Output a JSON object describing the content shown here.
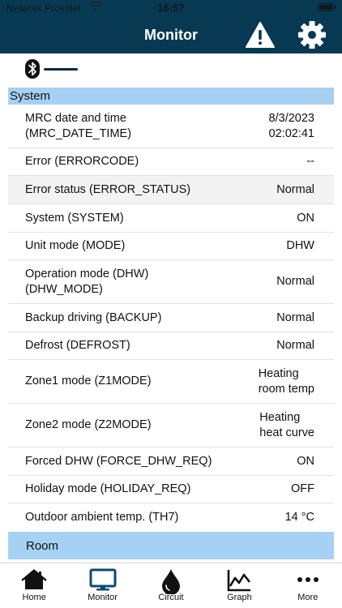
{
  "status_bar": {
    "carrier": "Network Provider",
    "time": "16:57"
  },
  "header": {
    "title": "Monitor"
  },
  "sections": {
    "system": "System",
    "room": "Room"
  },
  "rows": [
    {
      "label": "MRC date and time\n(MRC_DATE_TIME)",
      "value": "8/3/2023\n02:02:41"
    },
    {
      "label": "Error (ERRORCODE)",
      "value": "--"
    },
    {
      "label": "Error status (ERROR_STATUS)",
      "value": "Normal"
    },
    {
      "label": "System (SYSTEM)",
      "value": "ON"
    },
    {
      "label": "Unit mode (MODE)",
      "value": "DHW"
    },
    {
      "label": "Operation mode (DHW)\n(DHW_MODE)",
      "value": "Normal"
    },
    {
      "label": "Backup driving (BACKUP)",
      "value": "Normal"
    },
    {
      "label": "Defrost (DEFROST)",
      "value": "Normal"
    },
    {
      "label": "Zone1 mode (Z1MODE)",
      "value": "Heating\nroom temp"
    },
    {
      "label": "Zone2 mode (Z2MODE)",
      "value": "Heating\nheat curve"
    },
    {
      "label": "Forced DHW (FORCE_DHW_REQ)",
      "value": "ON"
    },
    {
      "label": "Holiday mode (HOLIDAY_REQ)",
      "value": "OFF"
    },
    {
      "label": "Outdoor ambient temp. (TH7)",
      "value": "14 °C"
    }
  ],
  "tabs": [
    {
      "label": "Home",
      "icon": "home-icon"
    },
    {
      "label": "Monitor",
      "icon": "monitor-icon"
    },
    {
      "label": "Circuit",
      "icon": "drop-icon"
    },
    {
      "label": "Graph",
      "icon": "graph-icon"
    },
    {
      "label": "More",
      "icon": "more-icon"
    }
  ],
  "colors": {
    "header": "#073a52",
    "section": "#a7d1f4",
    "active_tab": "#0b4a6e"
  }
}
